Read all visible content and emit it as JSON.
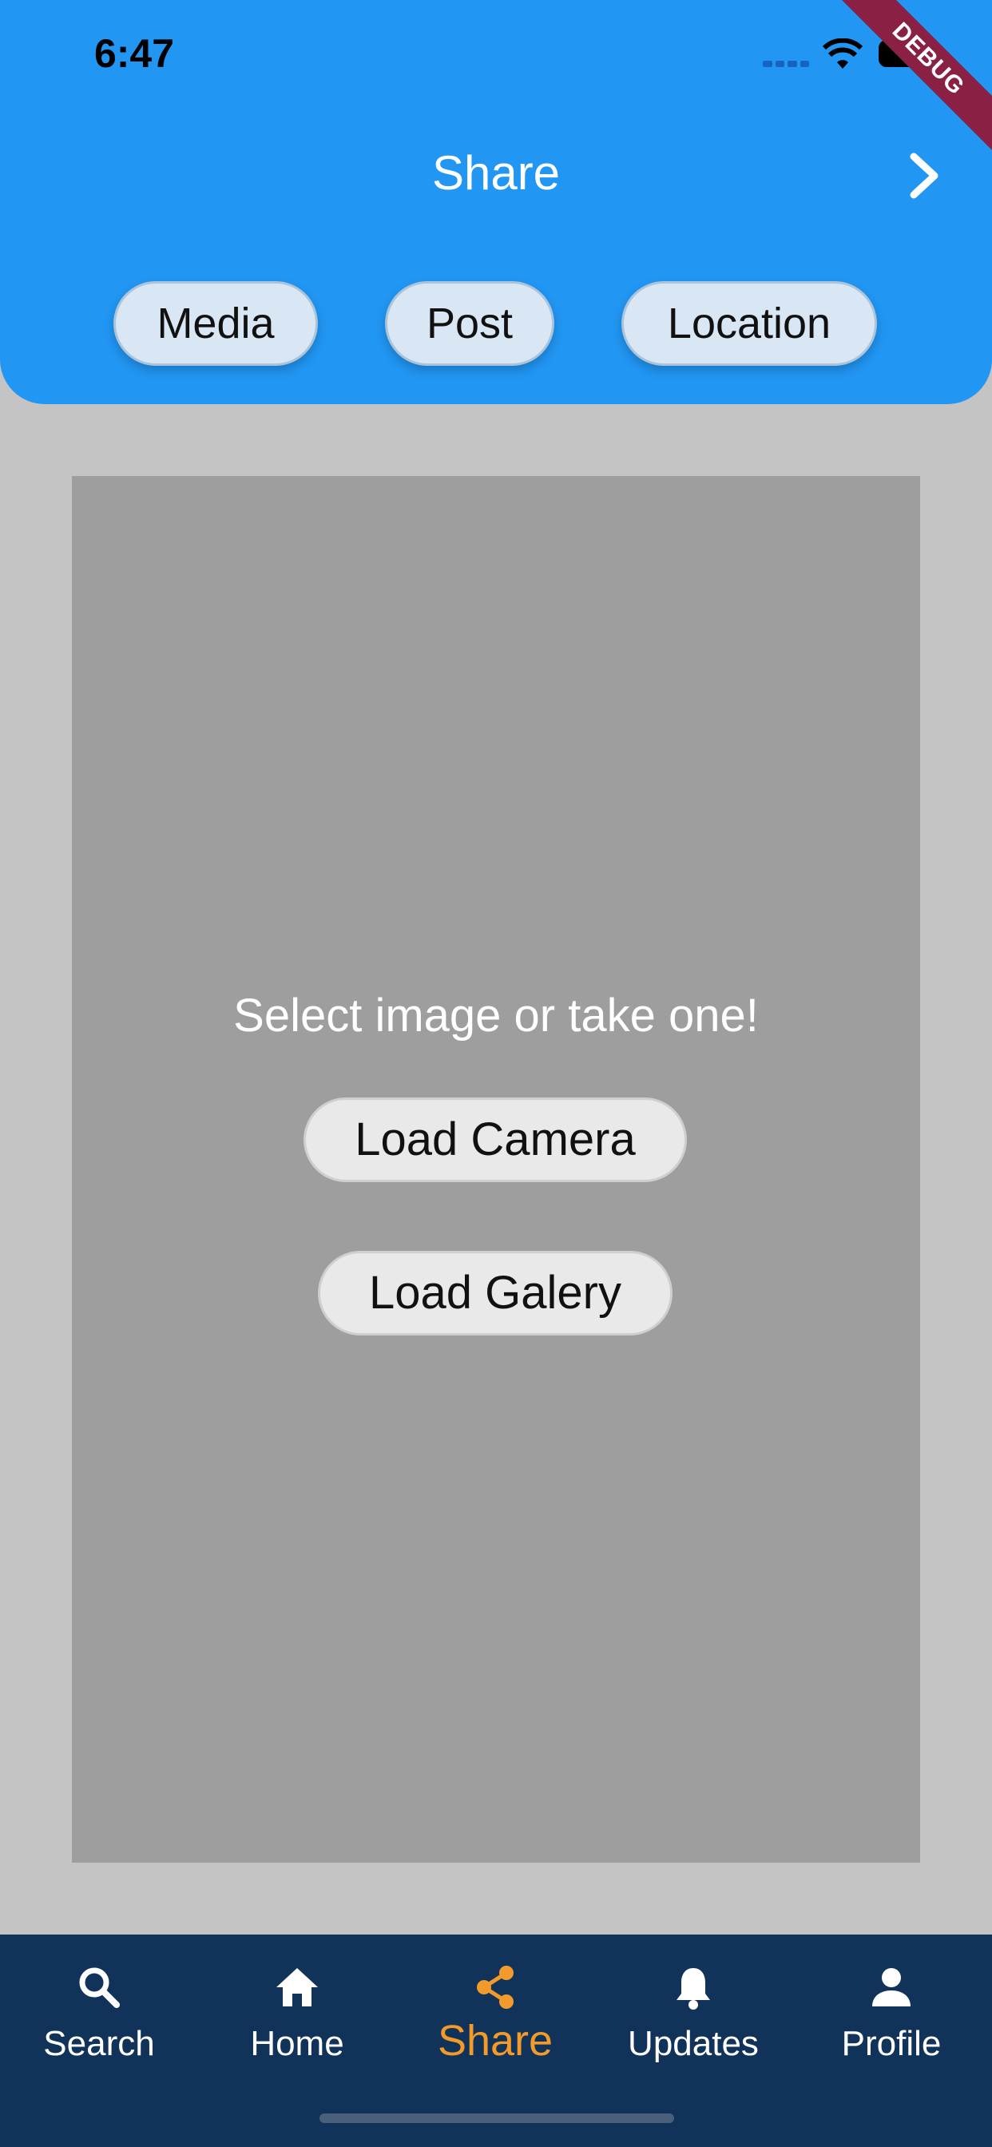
{
  "status_bar": {
    "time": "6:47"
  },
  "debug_banner": "DEBUG",
  "header": {
    "title": "Share",
    "chips": [
      "Media",
      "Post",
      "Location"
    ]
  },
  "content": {
    "prompt": "Select image or take one!",
    "load_camera": "Load Camera",
    "load_gallery": "Load Galery"
  },
  "bottom_nav": {
    "active": "Share",
    "items": [
      {
        "label": "Search",
        "icon": "search-icon"
      },
      {
        "label": "Home",
        "icon": "home-icon"
      },
      {
        "label": "Share",
        "icon": "share-icon"
      },
      {
        "label": "Updates",
        "icon": "bell-icon"
      },
      {
        "label": "Profile",
        "icon": "person-icon"
      }
    ]
  },
  "colors": {
    "header": "#2196f3",
    "nav_background": "#11335a",
    "active": "#f39b2a",
    "panel": "#9e9e9e",
    "background": "#c4c4c4"
  }
}
